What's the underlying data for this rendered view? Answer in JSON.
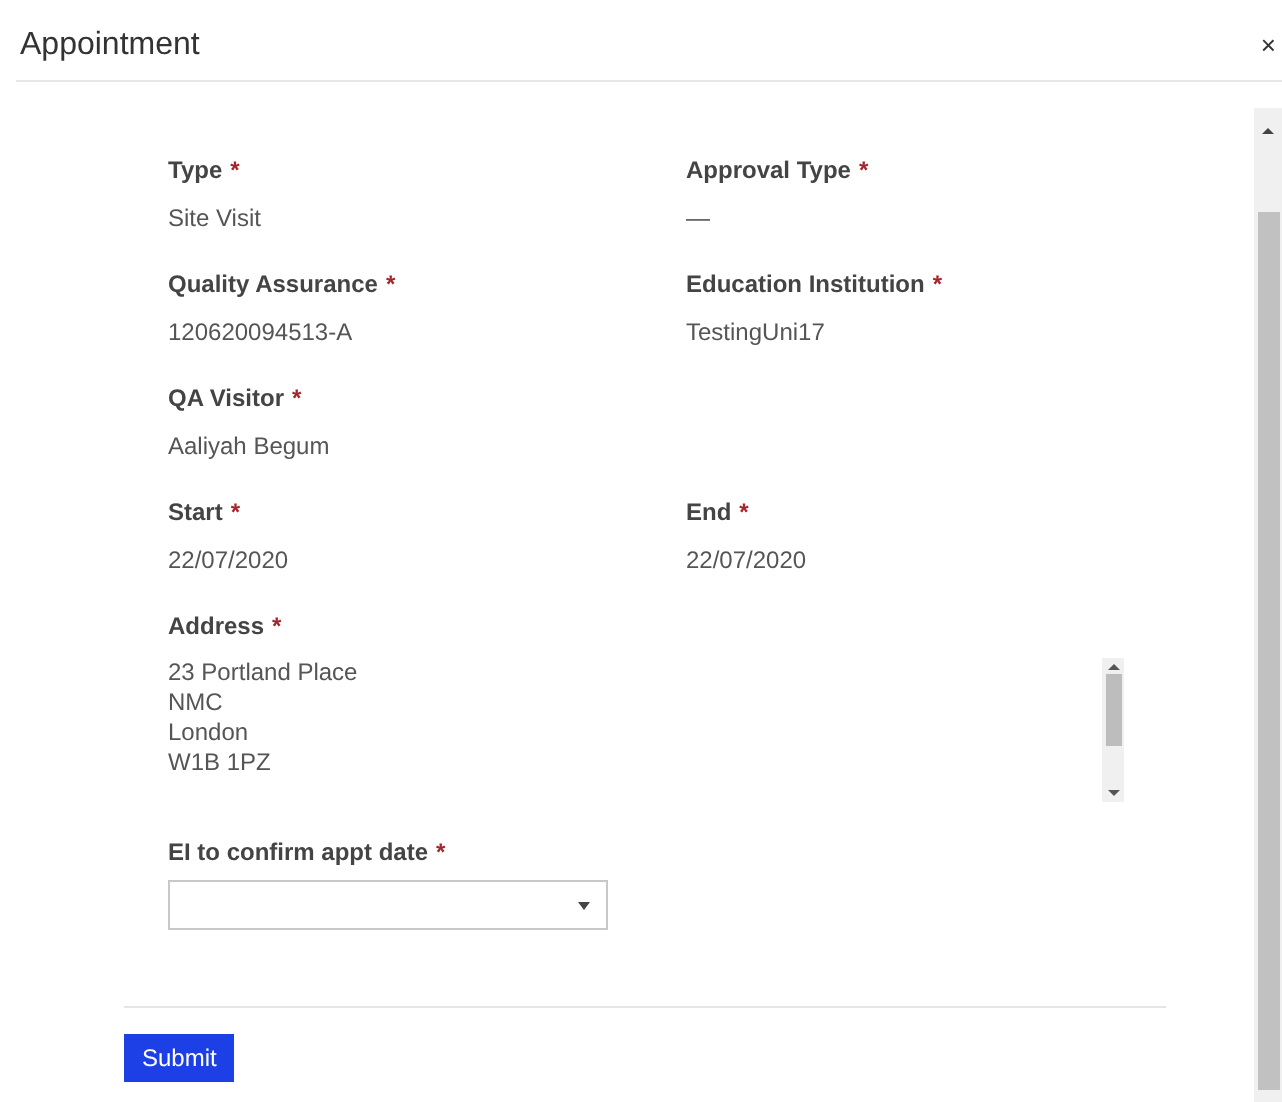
{
  "dialog": {
    "title": "Appointment",
    "close": "×"
  },
  "rows": [
    [
      {
        "kind": "text",
        "label": "Type",
        "required_mark": "*",
        "value": "Site Visit"
      },
      {
        "kind": "text",
        "label": "Approval Type",
        "required_mark": "*",
        "value": "—"
      }
    ],
    [
      {
        "kind": "text",
        "label": "Quality Assurance",
        "required_mark": "*",
        "value": "120620094513-A"
      },
      {
        "kind": "text",
        "label": "Education Institution",
        "required_mark": "*",
        "value": "TestingUni17"
      }
    ],
    [
      {
        "kind": "text",
        "label": "QA Visitor",
        "required_mark": "*",
        "value": "Aaliyah Begum"
      }
    ],
    [
      {
        "kind": "text",
        "label": "Start",
        "required_mark": "*",
        "value": "22/07/2020"
      },
      {
        "kind": "text",
        "label": "End",
        "required_mark": "*",
        "value": "22/07/2020"
      }
    ],
    [
      {
        "kind": "textarea",
        "label": "Address",
        "required_mark": "*",
        "lines": [
          "23 Portland Place",
          "NMC",
          "London",
          "W1B 1PZ"
        ]
      }
    ],
    [
      {
        "kind": "select",
        "label": "EI to confirm appt date",
        "required_mark": "*"
      }
    ]
  ],
  "submit": "Submit"
}
